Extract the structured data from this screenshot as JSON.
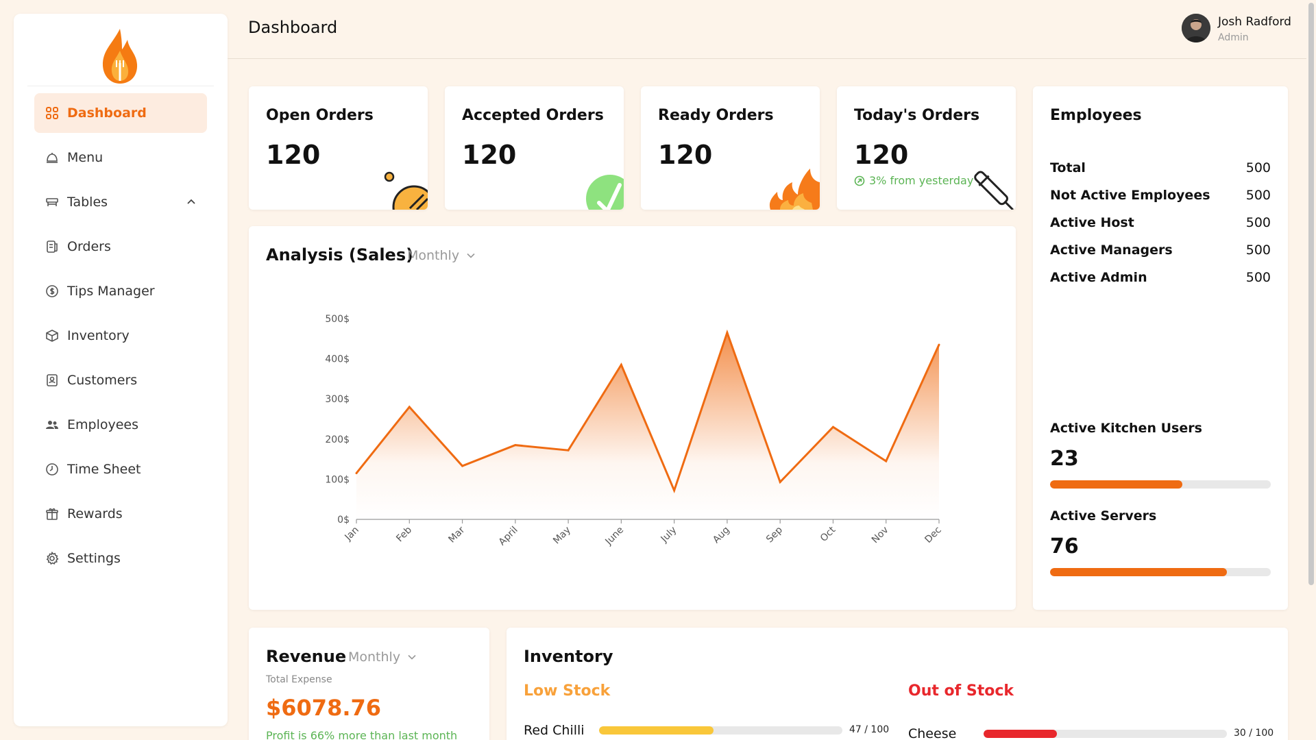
{
  "sidebar": {
    "items": [
      {
        "label": "Dashboard",
        "icon": "grid-icon",
        "active": true
      },
      {
        "label": "Menu",
        "icon": "cloche-icon"
      },
      {
        "label": "Tables",
        "icon": "table-icon",
        "expandable": true
      },
      {
        "label": "Orders",
        "icon": "receipt-icon"
      },
      {
        "label": "Tips Manager",
        "icon": "coin-icon"
      },
      {
        "label": "Inventory",
        "icon": "box-icon"
      },
      {
        "label": "Customers",
        "icon": "customer-badge-icon"
      },
      {
        "label": "Employees",
        "icon": "people-icon"
      },
      {
        "label": "Time Sheet",
        "icon": "clock-icon"
      },
      {
        "label": "Rewards",
        "icon": "gift-icon"
      },
      {
        "label": "Settings",
        "icon": "gear-icon"
      }
    ]
  },
  "header": {
    "title": "Dashboard",
    "user_name": "Josh Radford",
    "user_role": "Admin"
  },
  "stats": [
    {
      "title": "Open Orders",
      "value": "120",
      "sub": ""
    },
    {
      "title": "Accepted Orders",
      "value": "120",
      "sub": ""
    },
    {
      "title": "Ready Orders",
      "value": "120",
      "sub": ""
    },
    {
      "title": "Today's Orders",
      "value": "120",
      "sub": "3% from yesterday"
    }
  ],
  "employees": {
    "title": "Employees",
    "rows": [
      {
        "label": "Total",
        "value": "500"
      },
      {
        "label": "Not Active Employees",
        "value": "500"
      },
      {
        "label": "Active Host",
        "value": "500"
      },
      {
        "label": "Active Managers",
        "value": "500"
      },
      {
        "label": "Active Admin",
        "value": "500"
      }
    ],
    "kitchen_label": "Active Kitchen Users",
    "kitchen_value": "23",
    "kitchen_progress": 0.6,
    "servers_label": "Active Servers",
    "servers_value": "76",
    "servers_progress": 0.8
  },
  "analysis": {
    "title": "Analysis (Sales)",
    "period": "Monthly"
  },
  "chart_data": {
    "type": "area",
    "categories": [
      "Jan",
      "Feb",
      "Mar",
      "April",
      "May",
      "June",
      "July",
      "Aug",
      "Sep",
      "Oct",
      "Nov",
      "Dec"
    ],
    "series": [
      {
        "values": [
          115,
          280,
          133,
          185,
          172,
          385,
          72,
          465,
          93,
          230,
          145,
          435
        ]
      }
    ],
    "y_ticks": [
      "0$",
      "100$",
      "200$",
      "300$",
      "400$",
      "500$"
    ],
    "ylim": [
      0,
      500
    ],
    "color": "#ef6b12",
    "grid": false
  },
  "revenue": {
    "title": "Revenue",
    "period": "Monthly",
    "subtitle": "Total Expense",
    "amount": "$6078.76",
    "note": "Profit is 66% more than last month"
  },
  "inventory": {
    "title": "Inventory",
    "low_stock_title": "Low Stock",
    "out_of_stock_title": "Out of Stock",
    "low_stock": [
      {
        "name": "Red Chilli",
        "count": "47 / 100",
        "fraction": 0.47
      }
    ],
    "out_of_stock": [
      {
        "name": "Cheese",
        "count": "30 / 100",
        "fraction": 0.3
      }
    ]
  },
  "colors": {
    "accent": "#ef6b12",
    "positive": "#5bb454",
    "low_stock": "#f8a13a",
    "low_stock_bar": "#f9c73a",
    "out_of_stock": "#e8272c"
  }
}
